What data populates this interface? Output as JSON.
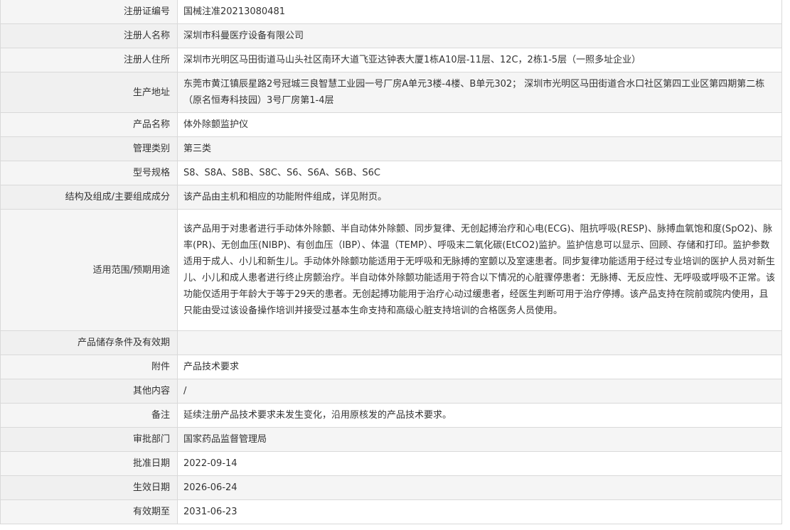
{
  "rows": [
    {
      "label": "注册证编号",
      "value": "国械注准20213080481"
    },
    {
      "label": "注册人名称",
      "value": "深圳市科曼医疗设备有限公司"
    },
    {
      "label": "注册人住所",
      "value": "深圳市光明区马田街道马山头社区南环大道飞亚达钟表大厦1栋A10层-11层、12C，2栋1-5层（一照多址企业）"
    },
    {
      "label": "生产地址",
      "value": "东莞市黄江镇辰星路2号冠城三良智慧工业园一号厂房A单元3楼-4楼、B单元302； 深圳市光明区马田街道合水口社区第四工业区第四期第二栋（原名恒寿科技园）3号厂房第1-4层"
    },
    {
      "label": "产品名称",
      "value": "体外除颤监护仪"
    },
    {
      "label": "管理类别",
      "value": "第三类"
    },
    {
      "label": "型号规格",
      "value": "S8、S8A、S8B、S8C、S6、S6A、S6B、S6C"
    },
    {
      "label": "结构及组成/主要组成成分",
      "value": "该产品由主机和相应的功能附件组成，详见附页。"
    },
    {
      "label": "适用范围/预期用途",
      "value": "该产品用于对患者进行手动体外除颤、半自动体外除颤、同步复律、无创起搏治疗和心电(ECG)、阻抗呼吸(RESP)、脉搏血氧饱和度(SpO2)、脉率(PR)、无创血压(NIBP)、有创血压（IBP）、体温（TEMP）、呼吸末二氧化碳(EtCO2)监护。监护信息可以显示、回顾、存储和打印。监护参数适用于成人、小儿和新生儿。手动体外除颤功能适用于无呼吸和无脉搏的室颤以及室速患者。同步复律功能适用于经过专业培训的医护人员对新生儿、小儿和成人患者进行终止房颤治疗。半自动体外除颤功能适用于符合以下情况的心脏骤停患者：无脉搏、无反应性、无呼吸或呼吸不正常。该功能仅适用于年龄大于等于29天的患者。无创起搏功能用于治疗心动过缓患者，经医生判断可用于治疗停搏。该产品支持在院前或院内使用，且只能由受过该设备操作培训并接受过基本生命支持和高级心脏支持培训的合格医务人员使用。"
    },
    {
      "label": "产品储存条件及有效期",
      "value": ""
    },
    {
      "label": "附件",
      "value": "产品技术要求"
    },
    {
      "label": "其他内容",
      "value": "/"
    },
    {
      "label": "备注",
      "value": "延续注册产品技术要求未发生变化，沿用原核发的产品技术要求。"
    },
    {
      "label": "审批部门",
      "value": "国家药品监督管理局"
    },
    {
      "label": "批准日期",
      "value": "2022-09-14"
    },
    {
      "label": "生效日期",
      "value": "2026-06-24"
    },
    {
      "label": "有效期至",
      "value": "2031-06-23"
    }
  ]
}
